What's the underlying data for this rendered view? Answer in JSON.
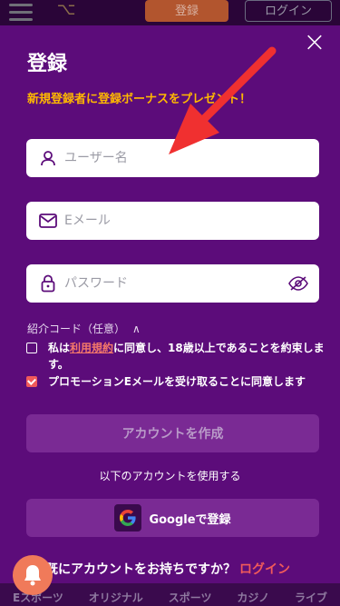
{
  "background": {
    "header": {
      "logo": "⌥",
      "register_label": "登録",
      "login_label": "ログイン"
    },
    "bottom_nav": [
      "Eスポーツ",
      "オリジナル",
      "スポーツ",
      "カジノ",
      "ライブ"
    ]
  },
  "modal": {
    "close_label": "×",
    "title": "登録",
    "promo": "新規登録者に登録ボーナスをプレゼント！",
    "username_placeholder": "ユーザー名",
    "email_placeholder": "Eメール",
    "password_placeholder": "パスワード",
    "referral_label": "紹介コード（任意）",
    "referral_chevron": "∧",
    "terms": {
      "prefix": "私は",
      "link": "利用規約",
      "suffix": "に同意し、18歳以上であることを約束します。",
      "checked": false
    },
    "promo_email": {
      "label": "プロモーションEメールを受け取ることに同意します",
      "checked": true
    },
    "create_button": "アカウントを作成",
    "use_account_text": "以下のアカウントを使用する",
    "google_button": "Googleで登録",
    "have_account_text": "既にアカウントをお持ちですか？",
    "login_link": "ログイン"
  },
  "colors": {
    "modal_bg": "#5c0c7a",
    "promo": "#ffb800",
    "accent": "#f05a5a",
    "annotation_arrow": "#f03030"
  }
}
